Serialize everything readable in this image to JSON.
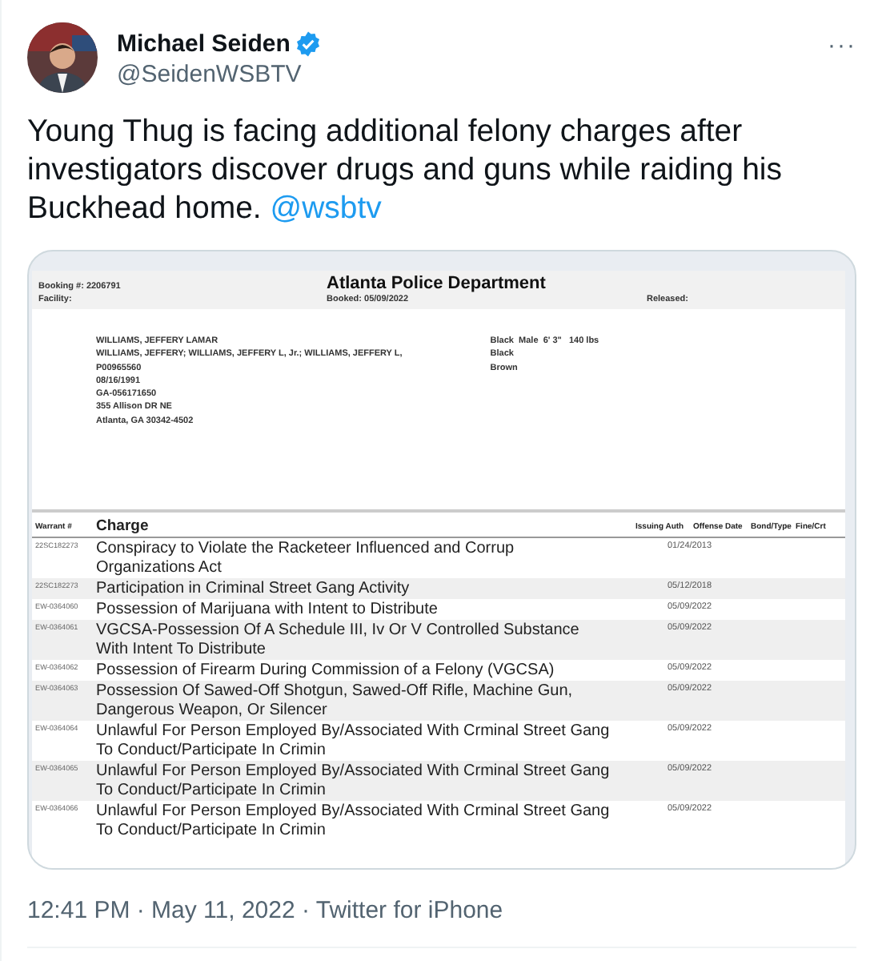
{
  "author": {
    "name": "Michael Seiden",
    "verified": true,
    "handle": "@SeidenWSBTV"
  },
  "more": "···",
  "text": "Young Thug is facing additional felony charges after investigators discover drugs and guns while raiding his Buckhead home.",
  "mention": "@wsbtv",
  "document": {
    "booking": "Booking #: 2206791",
    "facility": "Facility:",
    "agency": "Atlanta Police Department",
    "booked": "Booked: 05/09/2022",
    "released": "Released:",
    "person_lines": [
      "WILLIAMS, JEFFERY LAMAR",
      "WILLIAMS, JEFFERY; WILLIAMS, JEFFERY L, Jr.; WILLIAMS, JEFFERY L,",
      "P00965560",
      "08/16/1991",
      "GA-056171650",
      "355 Allison DR NE",
      "Atlanta, GA 30342-4502"
    ],
    "traits": [
      "Black  Male  6' 3\"   140 lbs",
      "Black",
      "Brown"
    ],
    "columns": [
      "Warrant #",
      "Charge",
      "Issuing Auth",
      "Offense Date",
      "Bond/Type",
      "Fine/Crt"
    ],
    "rows": [
      {
        "warrant": "22SC182273",
        "charge": "Conspiracy to Violate the Racketeer Influenced and Corrup\nOrganizations Act",
        "date": "01/24/2013"
      },
      {
        "warrant": "22SC182273",
        "charge": "Participation in Criminal Street Gang Activity",
        "date": "05/12/2018"
      },
      {
        "warrant": "EW-0364060",
        "charge": "Possession of Marijuana with Intent to Distribute",
        "date": "05/09/2022"
      },
      {
        "warrant": "EW-0364061",
        "charge": "VGCSA-Possession Of A Schedule III, Iv Or V Controlled Substance\nWith Intent To Distribute",
        "date": "05/09/2022"
      },
      {
        "warrant": "EW-0364062",
        "charge": "Possession of Firearm During Commission of a Felony (VGCSA)",
        "date": "05/09/2022"
      },
      {
        "warrant": "EW-0364063",
        "charge": "Possession Of Sawed-Off Shotgun, Sawed-Off Rifle, Machine Gun,\nDangerous Weapon, Or Silencer",
        "date": "05/09/2022"
      },
      {
        "warrant": "EW-0364064",
        "charge": "Unlawful For Person Employed By/Associated With Crminal Street Gang\nTo Conduct/Participate In Crimin",
        "date": "05/09/2022"
      },
      {
        "warrant": "EW-0364065",
        "charge": "Unlawful For Person Employed By/Associated With Crminal Street Gang\nTo Conduct/Participate In Crimin",
        "date": "05/09/2022"
      },
      {
        "warrant": "EW-0364066",
        "charge": "Unlawful For Person Employed By/Associated With Crminal Street Gang\nTo Conduct/Participate In Crimin",
        "date": "05/09/2022"
      }
    ]
  },
  "footer": "12:41 PM · May 11, 2022 · Twitter for iPhone"
}
